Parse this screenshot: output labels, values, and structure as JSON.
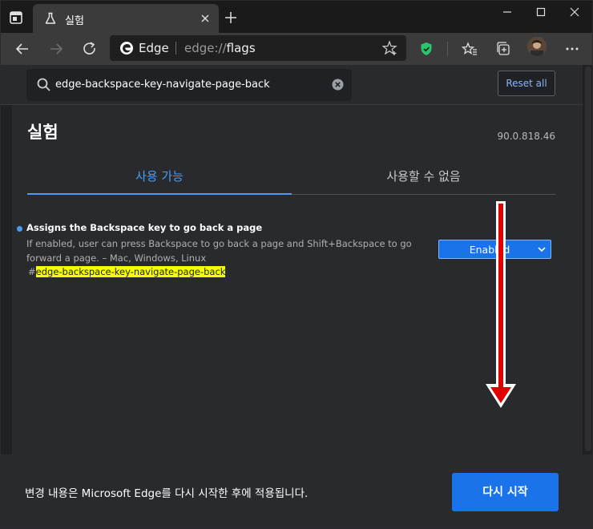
{
  "tab": {
    "title": "실험"
  },
  "omnibox": {
    "site_label": "Edge",
    "url_dim": "edge://",
    "url_host": "flags"
  },
  "header": {
    "search_value": "edge-backspace-key-navigate-page-back",
    "reset_label": "Reset all"
  },
  "main": {
    "title": "실험",
    "version": "90.0.818.46",
    "tabs": [
      {
        "label": "사용 가능",
        "active": true
      },
      {
        "label": "사용할 수 없음",
        "active": false
      }
    ]
  },
  "experiment": {
    "title": "Assigns the Backspace key to go back a page",
    "description": "If enabled, user can press Backspace to go back a page and Shift+Backspace to go forward a page. – Mac, Windows, Linux",
    "link_hash": "#",
    "link_name": "edge-backspace-key-navigate-page-back",
    "select_value": "Enabled"
  },
  "footer": {
    "message": "변경 내용은 Microsoft Edge를 다시 시작한 후에 적용됩니다.",
    "restart_label": "다시 시작"
  },
  "colors": {
    "accent": "#1a73e8",
    "link_tab": "#4a9cf5",
    "highlight": "#f5ff00",
    "annotation_arrow": "#e00000"
  },
  "icons": [
    "tab-actions-icon",
    "flask-icon",
    "close-icon",
    "plus-icon",
    "minimize-icon",
    "maximize-icon",
    "window-close-icon",
    "back-icon",
    "forward-icon",
    "refresh-icon",
    "edge-logo-icon",
    "add-favorite-icon",
    "shield-icon",
    "favorites-icon",
    "collections-icon",
    "avatar",
    "more-icon",
    "search-icon",
    "clear-icon",
    "chevron-down-icon"
  ]
}
